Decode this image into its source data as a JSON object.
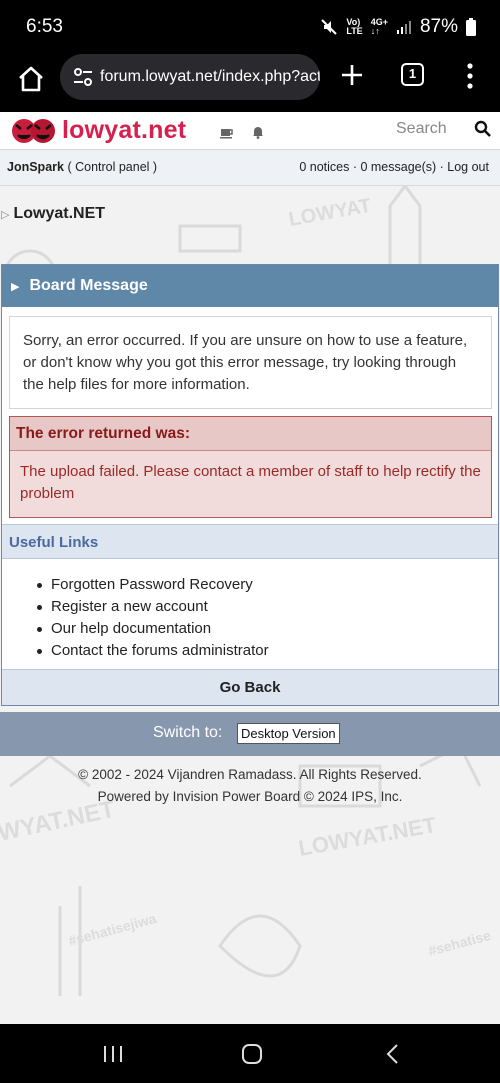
{
  "status": {
    "time": "6:53",
    "battery": "87%",
    "volte_top": "Vo)",
    "volte_bottom": "LTE",
    "net_top": "4G+",
    "net_bottom": "↓↑"
  },
  "browser": {
    "url": "forum.lowyat.net/index.php?act",
    "tab_count": "1"
  },
  "header": {
    "logo_text": "lowyat.net",
    "search_label": "Search"
  },
  "userbar": {
    "username": "JonSpark",
    "control_panel": "( Control panel )",
    "right_links": "0 notices · 0 message(s) · Log out"
  },
  "breadcrumb": {
    "label": "Lowyat.NET"
  },
  "board": {
    "title": "Board Message",
    "message": "Sorry, an error occurred. If you are unsure on how to use a feature, or don't know why you got this error message, try looking through the help files for more information.",
    "error_title": "The error returned was:",
    "error_text": "The upload failed. Please contact a member of staff to help rectify the problem",
    "useful_title": "Useful Links",
    "useful_links": [
      "Forgotten Password Recovery",
      "Register a new account",
      "Our help documentation",
      "Contact the forums administrator"
    ],
    "go_back": "Go Back"
  },
  "switch": {
    "label": "Switch to:",
    "button": "Desktop Version"
  },
  "footer": {
    "line1": "© 2002 - 2024 Vijandren Ramadass. All Rights Reserved.",
    "line2": "Powered by Invision Power Board © 2024  IPS, Inc."
  },
  "colors": {
    "brand": "#d6204f",
    "board_header": "#5e87a8",
    "error_text": "#9a2a2a",
    "switch_bar": "#8797ad"
  },
  "icons": [
    "mute-icon",
    "signal-icon",
    "battery-icon",
    "home-icon",
    "site-settings-icon",
    "new-tab-icon",
    "tabs-icon",
    "menu-icon",
    "coffee-icon",
    "bell-icon",
    "search-icon",
    "recents-icon",
    "home-nav-icon",
    "back-icon"
  ]
}
